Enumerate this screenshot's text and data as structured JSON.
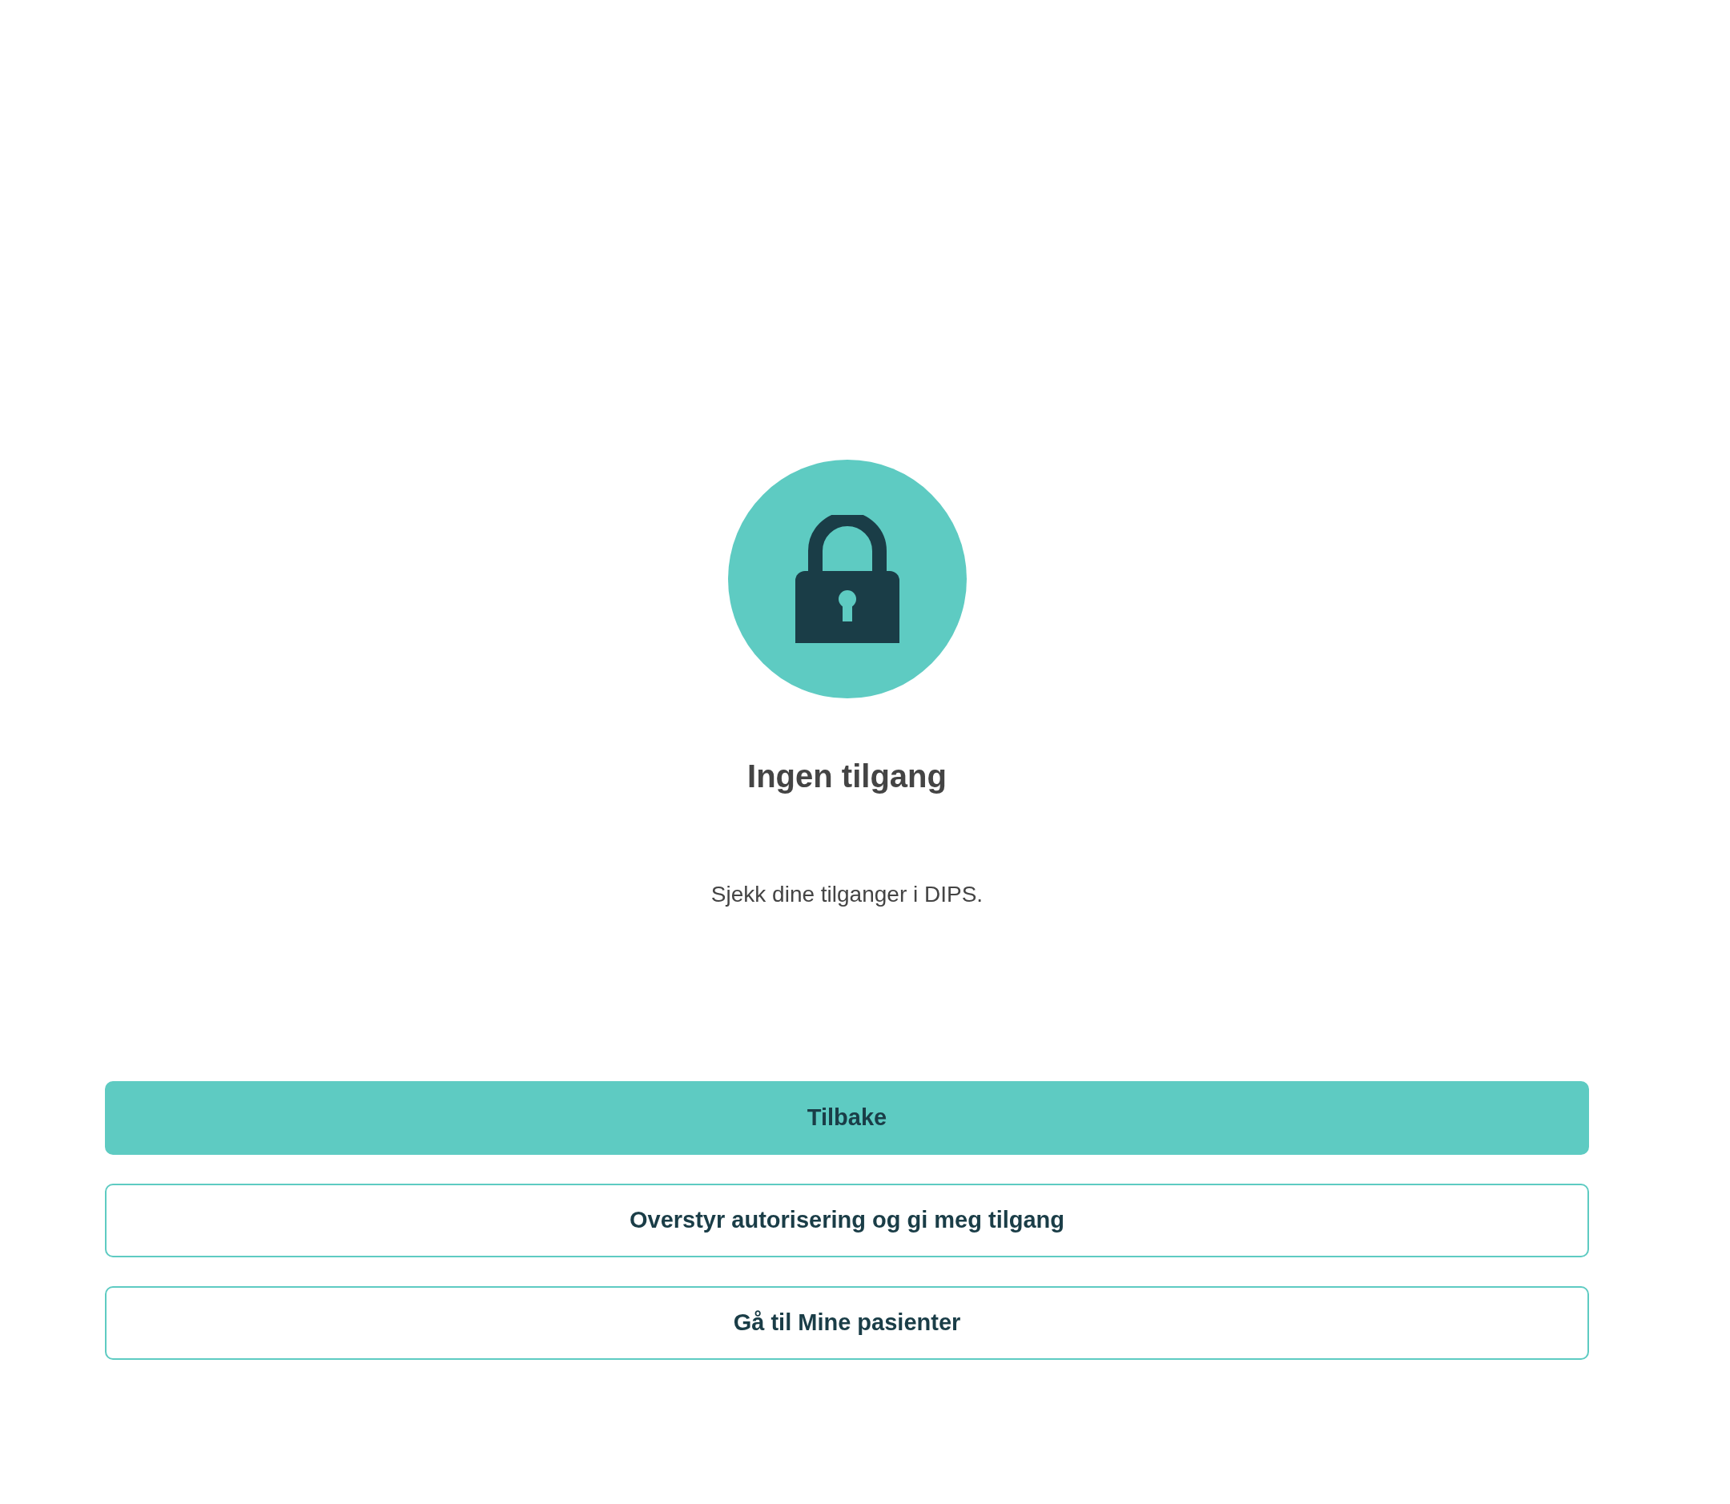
{
  "title": "Ingen tilgang",
  "message": "Sjekk dine tilganger i DIPS.",
  "buttons": [
    {
      "label": "Tilbake",
      "kind": "primary"
    },
    {
      "label": "Overstyr autorisering og gi meg tilgang",
      "kind": "outline"
    },
    {
      "label": "Gå til Mine pasienter",
      "kind": "outline"
    }
  ]
}
